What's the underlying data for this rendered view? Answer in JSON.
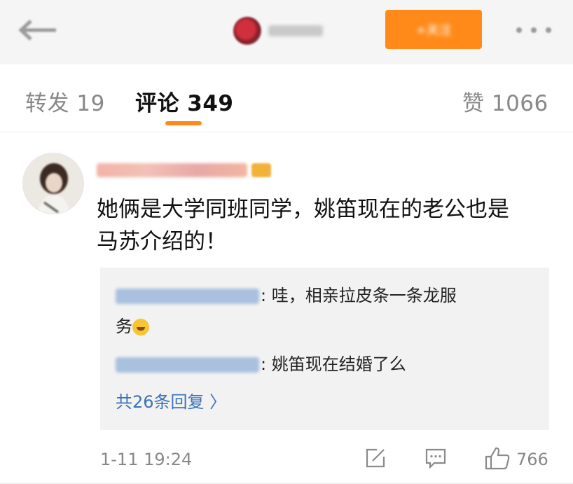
{
  "header": {
    "back_icon": "arrow-left-icon",
    "more_icon": "more-dots-icon",
    "follow_label": "+关注"
  },
  "tabs": [
    {
      "label": "转发 19"
    },
    {
      "label": "评论 349"
    },
    {
      "label": "赞 1066"
    }
  ],
  "comment": {
    "text_line1": "她俩是大学同班同学，姚笛现在的老公也是",
    "text_line2": "马苏介绍的！",
    "replies": [
      {
        "text_part1": ": 哇，相亲拉皮条一条龙服",
        "text_part2": "务"
      },
      {
        "text": ": 姚笛现在结婚了么"
      }
    ],
    "more_replies": "共26条回复 〉",
    "time": "1-11 19:24",
    "like_count": "766"
  },
  "colors": {
    "accent": "#ff8a1a",
    "link": "#3b73b8",
    "reply_bg": "#f2f2f2"
  }
}
